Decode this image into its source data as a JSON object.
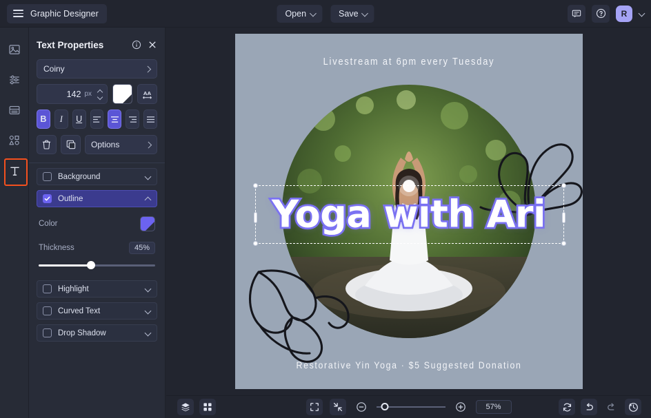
{
  "topbar": {
    "menu_icon": "hamburger-icon",
    "brand": "Graphic Designer",
    "open_label": "Open",
    "save_label": "Save",
    "comment_icon": "comment-icon",
    "help_icon": "help-circle-icon",
    "avatar_initial": "R"
  },
  "rail": {
    "items": [
      {
        "icon": "image-icon",
        "name": "sidebar-item-images",
        "selected": false
      },
      {
        "icon": "adjustments-icon",
        "name": "sidebar-item-adjust",
        "selected": false
      },
      {
        "icon": "layout-icon",
        "name": "sidebar-item-layouts",
        "selected": false
      },
      {
        "icon": "shapes-icon",
        "name": "sidebar-item-shapes",
        "selected": false
      },
      {
        "icon": "text-icon",
        "name": "sidebar-item-text",
        "selected": true
      }
    ]
  },
  "panel": {
    "title": "Text Properties",
    "info_icon": "info-circle-icon",
    "close_icon": "close-icon",
    "font_family": "Coiny",
    "font_size": "142",
    "font_size_unit": "px",
    "text_color": "#ffffff",
    "letter_spacing_icon": "letter-spacing-icon",
    "bold_label": "B",
    "italic_label": "I",
    "underline_label": "U",
    "active_style": "bold",
    "active_align": "center",
    "delete_icon": "trash-icon",
    "duplicate_icon": "duplicate-icon",
    "options_label": "Options",
    "sections": [
      {
        "label": "Background",
        "checked": false,
        "expanded": false
      },
      {
        "label": "Outline",
        "checked": true,
        "expanded": true
      },
      {
        "label": "Highlight",
        "checked": false,
        "expanded": false
      },
      {
        "label": "Curved Text",
        "checked": false,
        "expanded": false
      },
      {
        "label": "Drop Shadow",
        "checked": false,
        "expanded": false
      }
    ],
    "outline": {
      "color_label": "Color",
      "color_value": "#6c63f0",
      "thickness_label": "Thickness",
      "thickness_value": "45%",
      "thickness_pct": 45
    }
  },
  "canvas": {
    "background_color": "#9aa6b6",
    "top_caption": "Livestream at 6pm every Tuesday",
    "headline": "Yoga with Ari",
    "bottom_caption": "Restorative Yin Yoga · $5 Suggested Donation",
    "headline_fill": "#ffffff",
    "headline_outline": "#7b72f2"
  },
  "bottombar": {
    "layers_icon": "layers-icon",
    "grid_icon": "grid-icon",
    "fit_icon": "fit-to-screen-icon",
    "shrink_icon": "shrink-icon",
    "zoom_out_icon": "zoom-out-icon",
    "zoom_in_icon": "zoom-in-icon",
    "zoom_level": "57%",
    "zoom_pct": 12,
    "reset_icon": "reset-icon",
    "undo_icon": "undo-icon",
    "redo_icon": "redo-icon",
    "history_icon": "history-icon"
  }
}
